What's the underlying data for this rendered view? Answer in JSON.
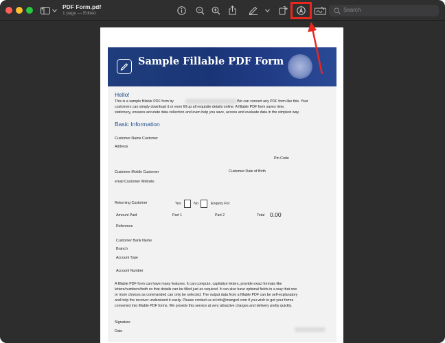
{
  "window": {
    "title": "PDF Form.pdf",
    "subtitle": "1 page — Edited",
    "search_placeholder": "Search"
  },
  "toolbar_icons": [
    "sidebar-icon",
    "chevron-down-icon",
    "info-icon",
    "zoom-out-icon",
    "zoom-in-icon",
    "share-icon",
    "pen-icon",
    "chevron-down-icon",
    "rotate-icon",
    "markup-icon",
    "signature-icon",
    "search-icon"
  ],
  "colors": {
    "annotation_highlight": "#e8281e",
    "banner": "#1f3d7c",
    "heading": "#1f4d8d"
  },
  "document": {
    "banner_title": "Sample Fillable PDF Form",
    "hello": "Hello!",
    "intro_line1_a": "This is a sample fillable PDF form by",
    "intro_line1_b": "We can convert any PDF form like this. Your",
    "intro_line2": "customers can simply download it or even fill up all requisite details online. A fillable PDF form saves time,",
    "intro_line3": "stationery, ensures accurate data collection and even help you save, access and evaluate data in the simplest way.",
    "section_title": "Basic Information",
    "fields": {
      "customer_name": "Customer Name Customer",
      "address": "Address",
      "pin_code": "Pin Code",
      "mobile": "Customer Mobile  Customer",
      "dob": "Customer Date of Birth",
      "email_website": "email Customer Website",
      "returning_customer": "Returning Customer",
      "yes": "Yes",
      "no": "No",
      "enquiry_for": "Enquiry For",
      "amount_paid": "Amount Paid",
      "part1": "Part 1",
      "part2": "Part 2",
      "total": "Total",
      "total_value": "0.00",
      "reference": "Reference",
      "bank_name": "Customer Bank Name",
      "branch": "Branch",
      "account_type": "Account Type",
      "account_number": "Account Number",
      "signature": "Signature",
      "date": "Date"
    },
    "para_line1": "A fillable PDF form can have many features. It can compute, capitalize letters, provide exact formats like",
    "para_line2": "letters/numbers/both so that details can be filled just as required. It can also have optional fields in a way that one",
    "para_line3": "or more choices as commanded can only be selected. The output data from a fillable PDF can be self-explanatory",
    "para_line4": "and help the receiver understand it easily. Please contact us at info@mangrol.com if you wish to get your forms",
    "para_line5": "converted into fillable PDF forms. We provide this service at very attractive charges and delivery pretty quickly."
  }
}
